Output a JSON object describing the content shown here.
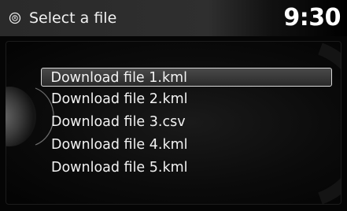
{
  "header": {
    "title": "Select a file",
    "clock": "9:30",
    "icon": "compass-dial-icon"
  },
  "files": [
    {
      "label": "Download file 1.kml",
      "selected": true
    },
    {
      "label": "Download file 2.kml",
      "selected": false
    },
    {
      "label": "Download file 3.csv",
      "selected": false
    },
    {
      "label": "Download file 4.kml",
      "selected": false
    },
    {
      "label": "Download file 5.kml",
      "selected": false
    }
  ],
  "colors": {
    "header_bg": "#2f2f2f",
    "highlight_border": "#d8d8d8",
    "text": "#f2f2f2"
  }
}
